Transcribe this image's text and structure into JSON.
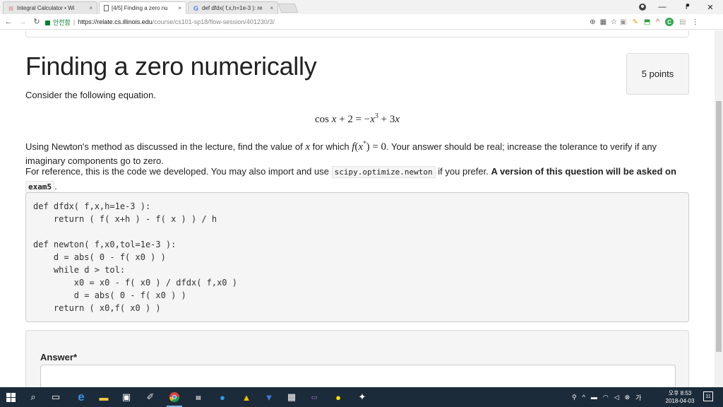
{
  "browser": {
    "tabs": [
      {
        "title": "Integral Calculator • Wi",
        "icon": "calculator-icon"
      },
      {
        "title": "[4/5] Finding a zero nu",
        "icon": "page-icon"
      },
      {
        "title": "def dfdx( f,x,h=1e-3 ): re",
        "icon": "google-icon"
      }
    ],
    "tab_close": "×",
    "window_min": "—",
    "window_max": "ᖰ",
    "window_close": "✕",
    "secure_label": "안전함",
    "url_base": "https://relate.cs.illinois.edu",
    "url_path": "/course/cs101-sp18/flow-session/401230/3/"
  },
  "page": {
    "title": "Finding a zero numerically",
    "points": "5 points",
    "intro": "Consider the following equation.",
    "paragraph1": {
      "a": "Using Newton's method as discussed in the lecture, find the value of ",
      "b": " for which ",
      "c": ". Your answer should be real; increase the tolerance to verify if any imaginary components go to zero."
    },
    "paragraph2": {
      "a": "For reference, this is the code we developed. You may also import and use ",
      "code": "scipy.optimize.newton",
      "b": " if you prefer. ",
      "bold": "A version of this question will be asked on ",
      "bold_code": "exam5",
      "end": "."
    },
    "code_lines": [
      "def dfdx( f,x,h=1e-3 ):",
      "    return ( f( x+h ) - f( x ) ) / h",
      "",
      "def newton( f,x0,tol=1e-3 ):",
      "    d = abs( 0 - f( x0 ) )",
      "    while d > tol:",
      "        x0 = x0 - f( x0 ) / dfdx( f,x0 )",
      "        d = abs( 0 - f( x0 ) )",
      "    return ( x0,f( x0 ) )"
    ],
    "answer_label": "Answer*"
  },
  "taskbar": {
    "clock_time": "오후 8:53",
    "clock_date": "2018-04-03",
    "lang": "가",
    "notif_count": "11"
  }
}
